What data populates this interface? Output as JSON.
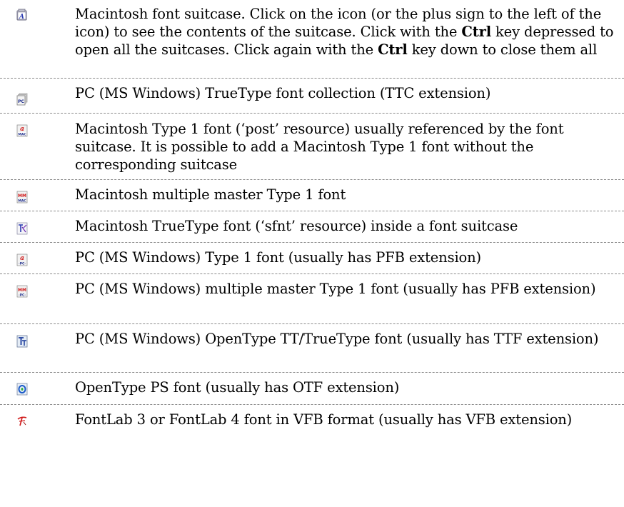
{
  "rows": [
    {
      "icon": "mac-font-suitcase-icon",
      "pre1": "Macintosh font suitcase. Click on the icon (or the plus sign to the left of the icon) to see the contents of the suitcase. Click with the ",
      "bold1": "Ctrl",
      "mid": " key depressed to open all the suitcases. Click again with the ",
      "bold2": "Ctrl",
      "post": " key down to close them all"
    },
    {
      "icon": "pc-ttc-collection-icon",
      "text": "PC (MS Windows) TrueType font collection (TTC extension)"
    },
    {
      "icon": "mac-type1-font-icon",
      "text": "Macintosh Type 1 font (‘post’ resource) usually referenced by the font suitcase. It is possible to add a Macintosh Type  1 font without the corresponding suitcase"
    },
    {
      "icon": "mac-multiple-master-icon",
      "text": "Macintosh multiple master Type 1 font"
    },
    {
      "icon": "mac-truetype-font-icon",
      "text": "Macintosh TrueType font (‘sfnt’ resource) inside a font suitcase"
    },
    {
      "icon": "pc-type1-font-icon",
      "text": "PC (MS Windows) Type 1 font (usually has PFB extension)"
    },
    {
      "icon": "pc-multiple-master-icon",
      "text": "PC (MS Windows) multiple master Type 1 font (usually has PFB extension)"
    },
    {
      "icon": "pc-opentype-tt-icon",
      "text": "PC (MS Windows) OpenType TT/TrueType font (usually has TTF extension)"
    },
    {
      "icon": "opentype-ps-icon",
      "text": "OpenType PS font (usually has OTF extension)"
    },
    {
      "icon": "fontlab-vfb-icon",
      "text": "FontLab 3 or FontLab 4  font in VFB format (usually has VFB extension)"
    }
  ]
}
